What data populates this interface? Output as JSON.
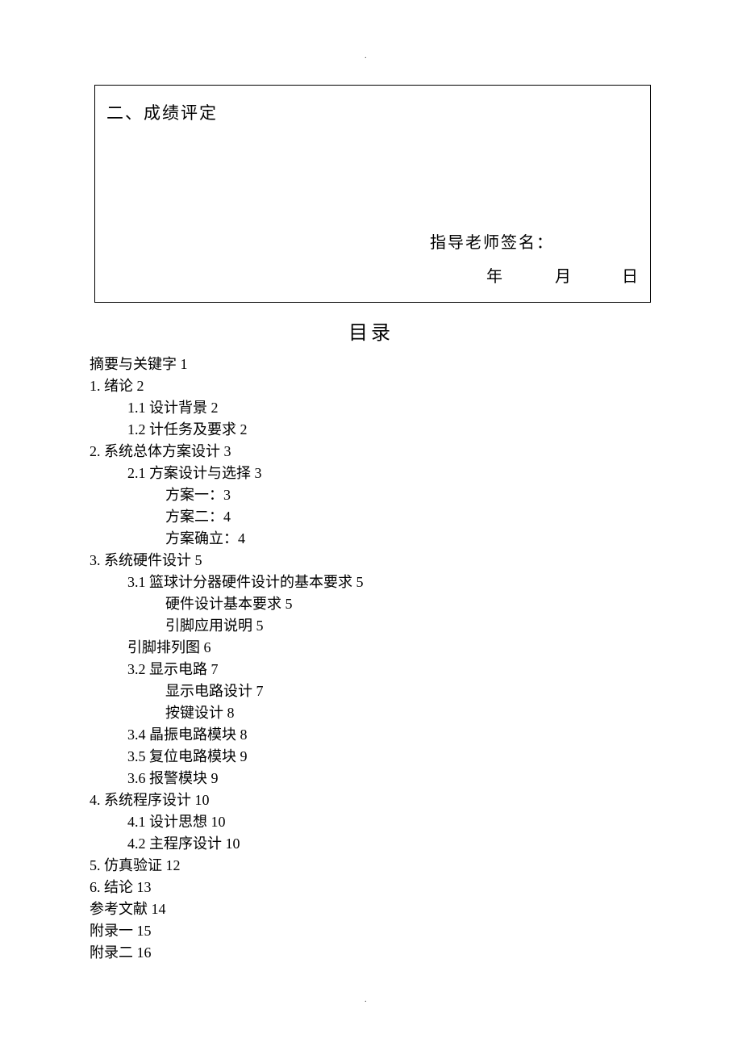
{
  "marks": {
    "top": ".",
    "bottom": "."
  },
  "grade_box": {
    "title": "二、成绩评定",
    "signature_label": "指导老师签名：",
    "date_year": "年",
    "date_month": "月",
    "date_day": "日"
  },
  "toc": {
    "heading": "目录",
    "items": [
      {
        "level": 0,
        "text": "摘要与关键字 1"
      },
      {
        "level": 0,
        "text": "1. 绪论 2"
      },
      {
        "level": 1,
        "text": "1.1 设计背景 2"
      },
      {
        "level": 1,
        "text": "1.2 计任务及要求 2"
      },
      {
        "level": 0,
        "text": "2. 系统总体方案设计 3"
      },
      {
        "level": 1,
        "text": "2.1 方案设计与选择 3"
      },
      {
        "level": 2,
        "text": "方案一：3"
      },
      {
        "level": 2,
        "text": "方案二：4"
      },
      {
        "level": 2,
        "text": "方案确立：4"
      },
      {
        "level": 0,
        "text": "3. 系统硬件设计 5"
      },
      {
        "level": 1,
        "text": "3.1 篮球计分器硬件设计的基本要求 5"
      },
      {
        "level": 2,
        "text": "硬件设计基本要求 5"
      },
      {
        "level": 2,
        "text": "引脚应用说明 5"
      },
      {
        "level": 1,
        "text": "引脚排列图 6"
      },
      {
        "level": 1,
        "text": "3.2 显示电路 7"
      },
      {
        "level": 2,
        "text": "显示电路设计 7"
      },
      {
        "level": 2,
        "text": "按键设计 8"
      },
      {
        "level": 1,
        "text": "3.4 晶振电路模块 8"
      },
      {
        "level": 1,
        "text": "3.5 复位电路模块 9"
      },
      {
        "level": 1,
        "text": "3.6 报警模块 9"
      },
      {
        "level": 0,
        "text": "4.  系统程序设计 10"
      },
      {
        "level": 1,
        "text": "4.1  设计思想 10"
      },
      {
        "level": 1,
        "text": "4.2  主程序设计 10"
      },
      {
        "level": 0,
        "text": "5. 仿真验证 12"
      },
      {
        "level": 0,
        "text": "6. 结论 13"
      },
      {
        "level": 0,
        "text": "参考文献 14"
      },
      {
        "level": 0,
        "text": "附录一 15"
      },
      {
        "level": 0,
        "text": "附录二 16"
      }
    ]
  }
}
